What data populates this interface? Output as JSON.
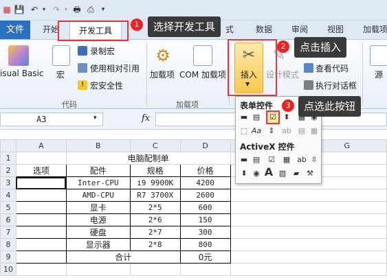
{
  "qat": {
    "save_icon": "save-icon",
    "undo_icon": "undo-icon",
    "redo_icon": "redo-icon",
    "print_icon": "print-icon"
  },
  "tabs": {
    "file": "文件",
    "home": "开始",
    "developer": "开发工具",
    "insert_partial": "式",
    "data": "数据",
    "review": "审阅",
    "view": "视图",
    "addins": "加载项"
  },
  "ribbon": {
    "vb": "isual Basic",
    "macros": "宏",
    "record_macro": "录制宏",
    "relative_ref": "使用相对引用",
    "macro_security": "宏安全性",
    "group_code": "代码",
    "addins": "加载项",
    "com_addins": "COM 加载项",
    "group_addins": "加载项",
    "insert": "插入",
    "design_mode": "设计模式",
    "view_code": "查看代码",
    "run_dialog": "执行对话框",
    "source": "源"
  },
  "callouts": {
    "c1": {
      "num": "1",
      "text": "选择开发工具"
    },
    "c2": {
      "num": "2",
      "text": "点击插入"
    },
    "c3": {
      "num": "3",
      "text": "点选此按钮"
    }
  },
  "dropdown": {
    "form_controls": "表单控件",
    "activex_controls": "ActiveX 控件"
  },
  "formula_bar": {
    "name_box": "A3",
    "fx": "fx",
    "value": ""
  },
  "sheet": {
    "columns": [
      "A",
      "B",
      "C",
      "D",
      "G"
    ],
    "rows": [
      "1",
      "2",
      "3",
      "4",
      "5",
      "6",
      "7",
      "8",
      "9",
      "10"
    ],
    "title": "电脑配制单",
    "headers": [
      "选项",
      "配件",
      "规格",
      "价格"
    ],
    "items": [
      {
        "part": "Inter-CPU",
        "spec": "i9 9900K",
        "price": "4200"
      },
      {
        "part": "AMD-CPU",
        "spec": "R7 3700X",
        "price": "2600"
      },
      {
        "part": "显卡",
        "spec": "2*5",
        "price": "600"
      },
      {
        "part": "电源",
        "spec": "2*6",
        "price": "150"
      },
      {
        "part": "硬盘",
        "spec": "2*7",
        "price": "300"
      },
      {
        "part": "显示器",
        "spec": "2*8",
        "price": "800"
      }
    ],
    "total_label": "合计",
    "total_value": "0元"
  },
  "colors": {
    "file_tab": "#2a70c0",
    "callout_bg": "#3a3a3a",
    "badge": "#e22222",
    "highlight_box": "#e53935"
  }
}
